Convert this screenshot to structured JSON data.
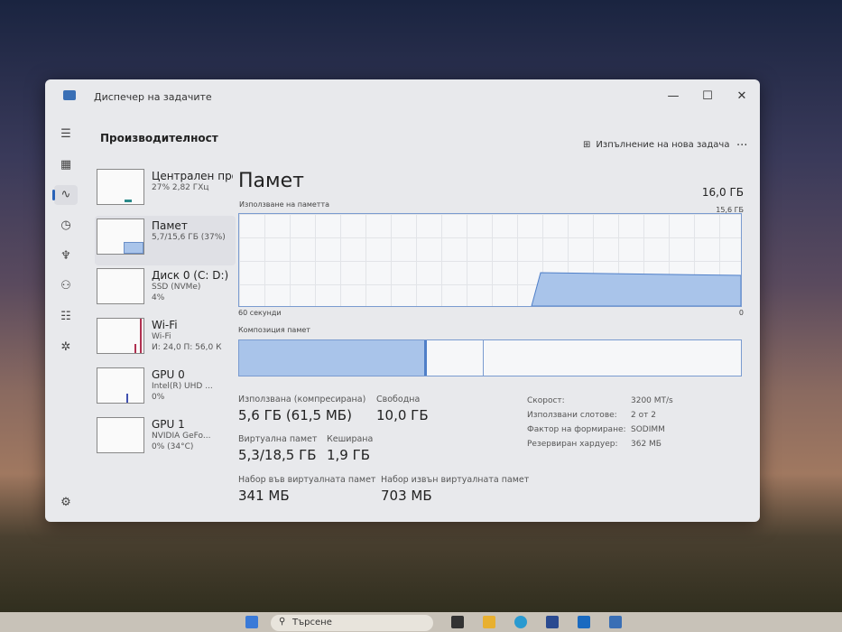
{
  "window": {
    "title": "Диспечер на задачите",
    "minimize": "—",
    "maximize": "☐",
    "close": "✕"
  },
  "header": {
    "title": "Производителност",
    "new_task": "Изпълнение на нова задача",
    "more": "···"
  },
  "nav": [
    "☰",
    "▦",
    "∿",
    "◷",
    "♆",
    "⚇",
    "☷",
    "✲",
    "⚙"
  ],
  "sidebar": [
    {
      "title": "Централен процесор",
      "l1": "27% 2,82 ГХц",
      "l2": ""
    },
    {
      "title": "Памет",
      "l1": "5,7/15,6 ГБ (37%)",
      "l2": ""
    },
    {
      "title": "Диск 0 (C: D:)",
      "l1": "SSD (NVMe)",
      "l2": "4%"
    },
    {
      "title": "Wi-Fi",
      "l1": "Wi-Fi",
      "l2": "И: 24,0 П: 56,0 К"
    },
    {
      "title": "GPU 0",
      "l1": "Intel(R) UHD ...",
      "l2": "0%"
    },
    {
      "title": "GPU 1",
      "l1": "NVIDIA GeFo...",
      "l2": "0% (34°C)"
    }
  ],
  "main": {
    "title": "Памет",
    "total": "16,0 ГБ",
    "usage_label": "Използване на паметта",
    "usage_max": "15,6 ГБ",
    "time_left": "60 секунди",
    "time_right": "0",
    "composition_label": "Композиция памет",
    "usage_percent": 37,
    "stats": {
      "used_label": "Използвана (компресирана)",
      "used": "5,6 ГБ (61,5 МБ)",
      "free_label": "Свободна",
      "free": "10,0 ГБ",
      "virtual_label": "Виртуална памет",
      "virtual": "5,3/18,5 ГБ",
      "cached_label": "Кеширана",
      "cached": "1,9 ГБ",
      "paged_label": "Набор във виртуалната памет",
      "paged": "341 МБ",
      "nonpaged_label": "Набор извън виртуалната памет",
      "nonpaged": "703 МБ"
    },
    "props": [
      {
        "k": "Скорост:",
        "v": "3200 MT/s"
      },
      {
        "k": "Използвани слотове:",
        "v": "2 от 2"
      },
      {
        "k": "Фактор на формиране:",
        "v": "SODIMM"
      },
      {
        "k": "Резервиран хардуер:",
        "v": "362 МБ"
      }
    ]
  },
  "taskbar": {
    "search": "Търсене"
  }
}
